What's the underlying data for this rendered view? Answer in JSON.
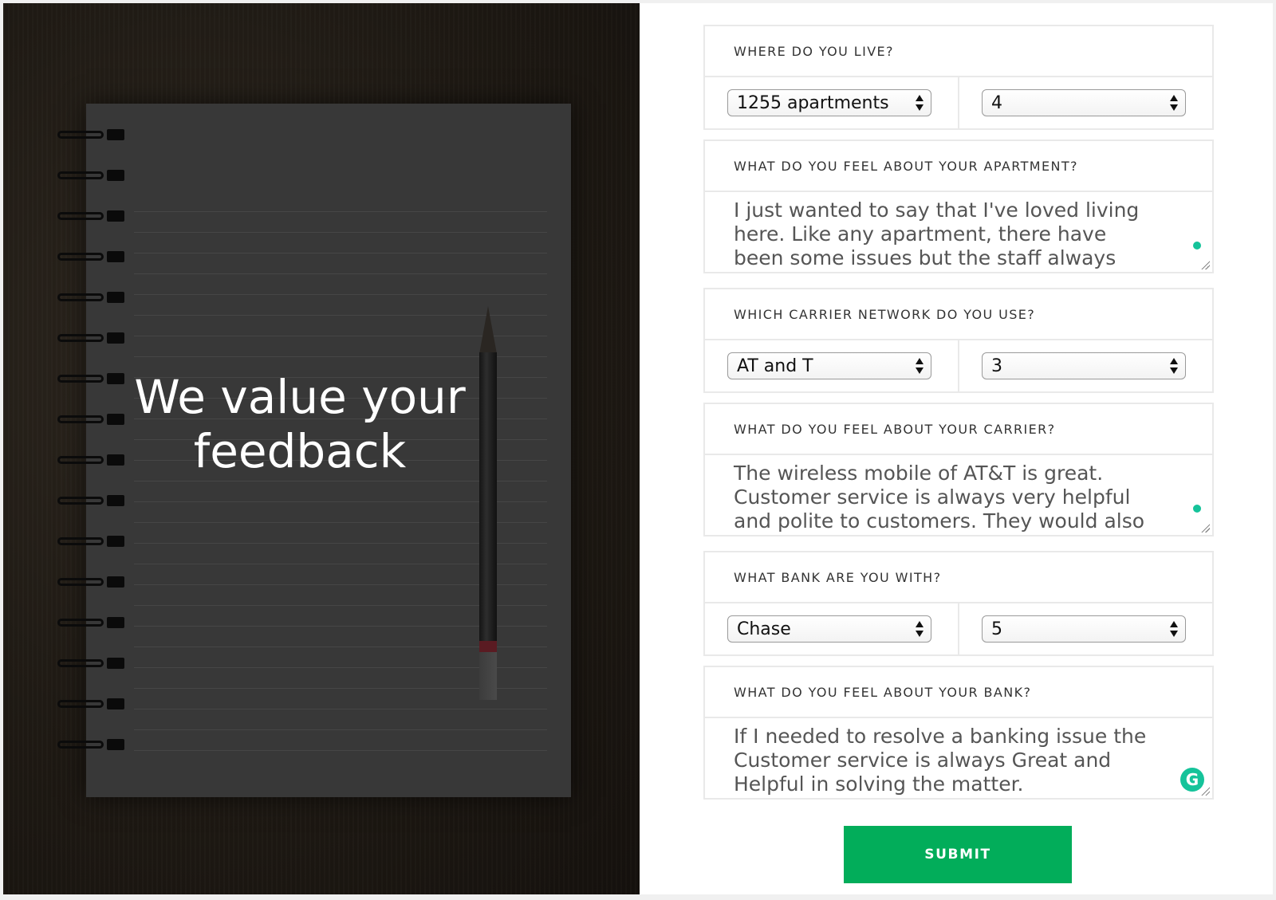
{
  "hero": {
    "headline_line1": "We value your",
    "headline_line2": "feedback"
  },
  "sections": {
    "residence": {
      "question": "WHERE DO YOU LIVE?",
      "place_selected": "1255 apartments",
      "rating_selected": "4"
    },
    "apartment_feedback": {
      "question": "WHAT DO YOU FEEL ABOUT YOUR APARTMENT?",
      "text": "I just wanted to say that I've loved living here. Like any apartment, there have been some issues but the staff always takes care of them quickly."
    },
    "carrier": {
      "question": "WHICH CARRIER NETWORK DO YOU USE?",
      "carrier_selected": "AT and T",
      "rating_selected": "3"
    },
    "carrier_feedback": {
      "question": "WHAT DO YOU FEEL ABOUT YOUR CARRIER?",
      "text": "The wireless mobile of AT&T is great. Customer service is always very helpful and polite to customers. They would also quote"
    },
    "bank": {
      "question": "WHAT BANK ARE YOU WITH?",
      "bank_selected": "Chase",
      "rating_selected": "5"
    },
    "bank_feedback": {
      "question": "WHAT DO YOU FEEL ABOUT YOUR BANK?",
      "text": "If I needed to resolve a banking issue the Customer service is always Great and Helpful in solving the matter."
    }
  },
  "submit_label": "SUBMIT",
  "icons": {
    "grammarly": "grammarly-icon",
    "select_arrows": "updown-arrows-icon"
  },
  "colors": {
    "submit_bg": "#02ad5a",
    "accent_dot": "#15c39a"
  }
}
